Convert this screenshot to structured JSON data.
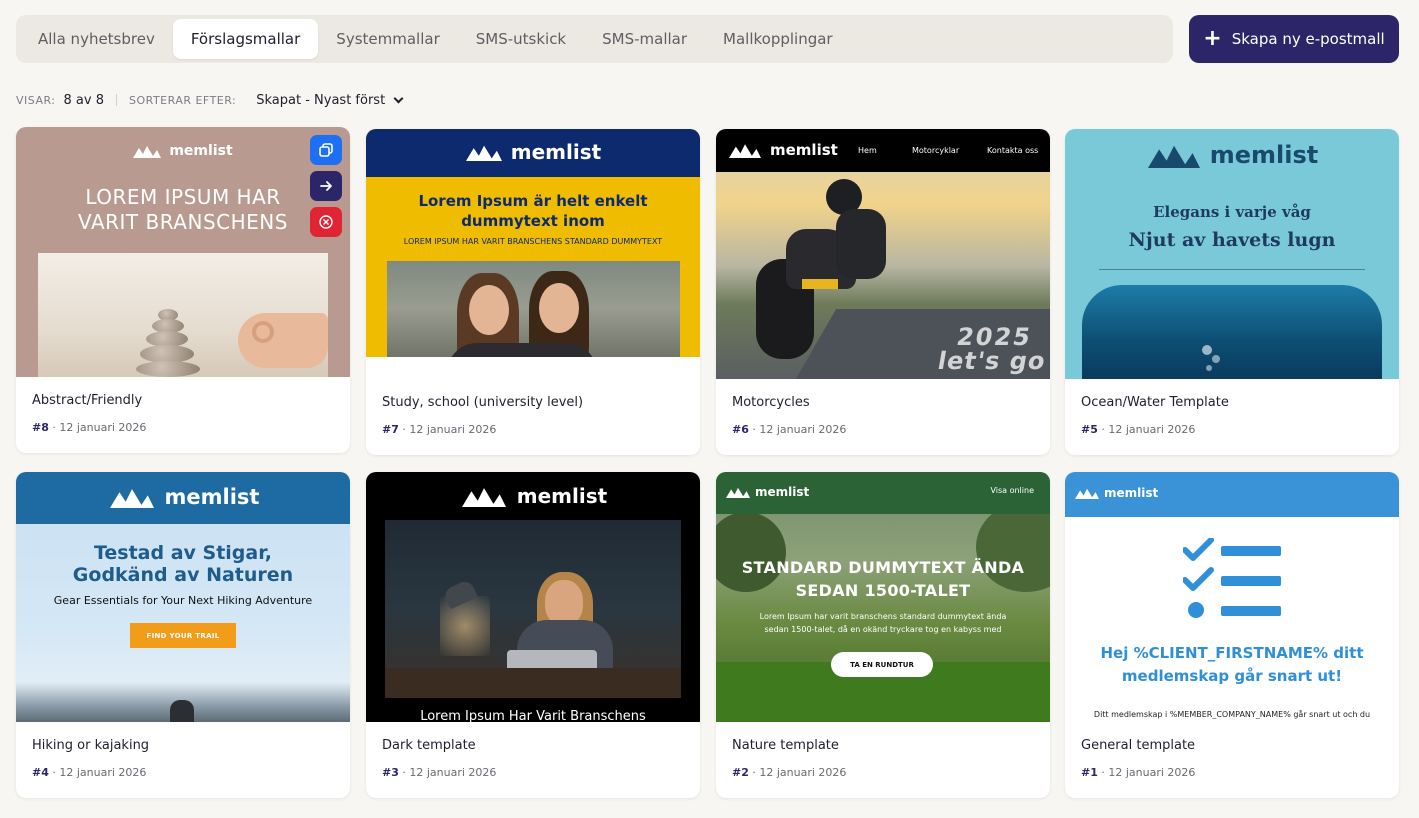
{
  "tabs": [
    {
      "label": "Alla nyhetsbrev",
      "active": false
    },
    {
      "label": "Förslagsmallar",
      "active": true
    },
    {
      "label": "Systemmallar",
      "active": false
    },
    {
      "label": "SMS-utskick",
      "active": false
    },
    {
      "label": "SMS-mallar",
      "active": false
    },
    {
      "label": "Mallkopplingar",
      "active": false
    }
  ],
  "create_button": {
    "label": "Skapa ny e-postmall",
    "icon": "plus-icon"
  },
  "meta": {
    "showing_label": "VISAR:",
    "showing_value": "8 av 8",
    "sort_label": "SORTERAR EFTER:",
    "sort_value": "Skapat - Nyast först"
  },
  "colors": {
    "accent": "#2c2669",
    "copy": "#1e6ff1",
    "delete": "#e02433"
  },
  "templates": [
    {
      "title": "Abstract/Friendly",
      "num": "#8",
      "date": " · 12 januari 2026",
      "preview": {
        "logo": "memlist",
        "headline1": "LOREM IPSUM HAR",
        "headline2": "VARIT BRANSCHENS"
      },
      "actions": [
        {
          "icon": "copy-icon"
        },
        {
          "icon": "arrow-right-icon"
        },
        {
          "icon": "close-circle-icon"
        }
      ]
    },
    {
      "title": "Study, school (university level)",
      "num": "#7",
      "date": " · 12 januari 2026",
      "preview": {
        "logo": "memlist",
        "headline1": "Lorem Ipsum är helt enkelt",
        "headline2": "dummytext inom",
        "sub": "LOREM IPSUM HAR VARIT BRANSCHENS STANDARD DUMMYTEXT"
      }
    },
    {
      "title": "Motorcycles",
      "num": "#6",
      "date": " · 12 januari 2026",
      "preview": {
        "logo": "memlist",
        "nav": [
          "Hem",
          "Motorcyklar",
          "Kontakta oss"
        ],
        "road1": "2025",
        "road2": "let's go"
      }
    },
    {
      "title": "Ocean/Water Template",
      "num": "#5",
      "date": " · 12 januari 2026",
      "preview": {
        "logo": "memlist",
        "line1": "Elegans i varje våg",
        "line2": "Njut av havets lugn"
      }
    },
    {
      "title": "Hiking or kajaking",
      "num": "#4",
      "date": " · 12 januari 2026",
      "preview": {
        "logo": "memlist",
        "headline1": "Testad av Stigar,",
        "headline2": "Godkänd av Naturen",
        "sub": "Gear Essentials for Your Next Hiking Adventure",
        "cta": "FIND YOUR TRAIL"
      }
    },
    {
      "title": "Dark template",
      "num": "#3",
      "date": " · 12 januari 2026",
      "preview": {
        "logo": "memlist",
        "caption": "Lorem Ipsum Har Varit Branschens"
      }
    },
    {
      "title": "Nature template",
      "num": "#2",
      "date": " · 12 januari 2026",
      "preview": {
        "logo": "memlist",
        "view_online": "Visa online",
        "headline1": "STANDARD DUMMYTEXT ÄNDA",
        "headline2": "SEDAN 1500-TALET",
        "sub1": "Lorem Ipsum har varit branschens standard dummytext ända",
        "sub2": "sedan 1500-talet, då en okänd tryckare tog en kabyss med",
        "cta": "TA EN RUNDTUR"
      }
    },
    {
      "title": "General template",
      "num": "#1",
      "date": " · 12 januari 2026",
      "preview": {
        "logo": "memlist",
        "headline1": "Hej %CLIENT_FIRSTNAME% ditt",
        "headline2": "medlemskap går snart ut!",
        "sub": "Ditt medlemskap i %MEMBER_COMPANY_NAME% går snart ut och du"
      }
    }
  ]
}
